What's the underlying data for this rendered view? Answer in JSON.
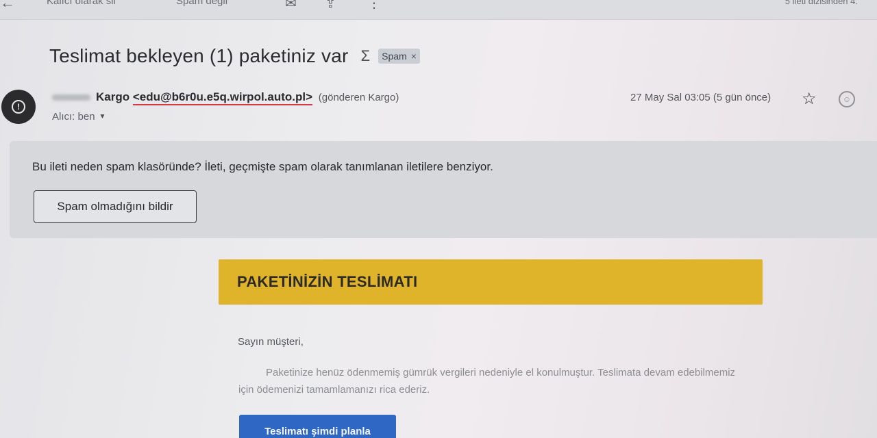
{
  "toolbar": {
    "delete_forever_label": "Kalıcı olarak sil",
    "not_spam_label": "Spam değil",
    "pager_text": "5 ileti dizisinden 4."
  },
  "email": {
    "subject": "Teslimat bekleyen (1) paketiniz var",
    "label": "Spam",
    "sender_name": "Kargo",
    "sender_email": "<edu@b6r0u.e5q.wirpol.auto.pl>",
    "via_text": "(gönderen Kargo)",
    "recipient_text": "Alıcı: ben",
    "date_text": "27 May Sal 03:05 (5 gün önce)"
  },
  "spam_notice": {
    "text": "Bu ileti neden spam klasöründe? İleti, geçmişte spam olarak tanımlanan iletilere benziyor.",
    "button_label": "Spam olmadığını bildir"
  },
  "body": {
    "banner_title": "PAKETİNİZİN TESLİMATI",
    "greeting": "Sayın müşteri,",
    "paragraph": "Paketinize henüz ödenmemiş gümrük vergileri nedeniyle el konulmuştur. Teslimata devam edebilmemiz için ödemenizi tamamlamanızı rica ederiz.",
    "cta_label": "Teslimatı şimdi planla"
  },
  "colors": {
    "banner": "#dfb32a",
    "cta": "#2f67c4",
    "email_underline": "#d23a45"
  }
}
